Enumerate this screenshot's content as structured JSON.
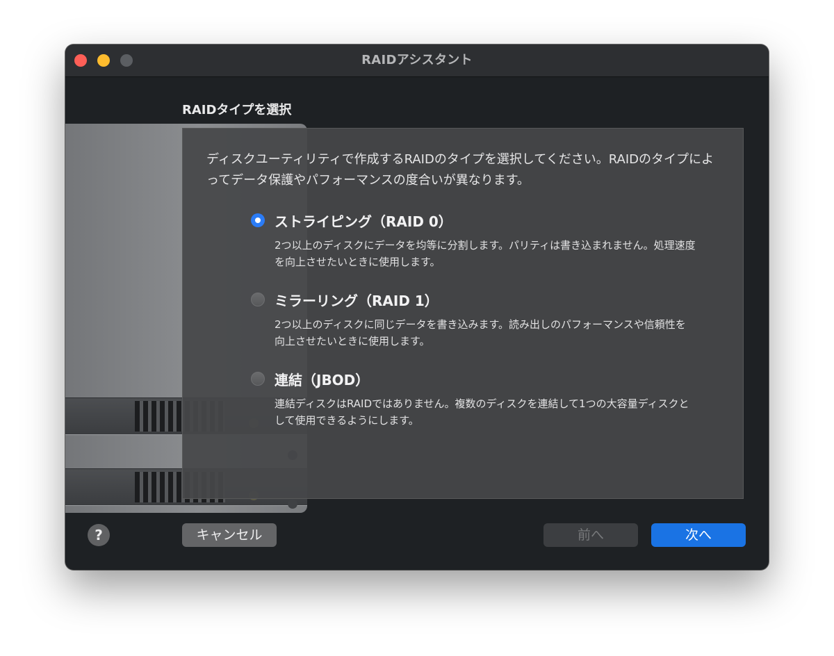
{
  "window": {
    "title": "RAIDアシスタント"
  },
  "page": {
    "section_title": "RAIDタイプを選択",
    "intro": "ディスクユーティリティで作成するRAIDのタイプを選択してください。RAIDのタイプによってデータ保護やパフォーマンスの度合いが異なります。"
  },
  "options": [
    {
      "label": "ストライピング（RAID 0）",
      "description": "2つ以上のディスクにデータを均等に分割します。パリティは書き込まれません。処理速度を向上させたいときに使用します。",
      "selected": true
    },
    {
      "label": "ミラーリング（RAID 1）",
      "description": "2つ以上のディスクに同じデータを書き込みます。読み出しのパフォーマンスや信頼性を向上させたいときに使用します。",
      "selected": false
    },
    {
      "label": "連結（JBOD）",
      "description": "連結ディスクはRAIDではありません。複数のディスクを連結して1つの大容量ディスクとして使用できるようにします。",
      "selected": false
    }
  ],
  "buttons": {
    "help": "?",
    "cancel": "キャンセル",
    "previous": "前へ",
    "next": "次へ",
    "previous_enabled": false
  },
  "colors": {
    "accent": "#1a73e4",
    "radio_selected": "#2b7cf6",
    "window_background": "#1e2124",
    "panel_background": "#464749"
  },
  "icons": {
    "help": "question-mark-icon",
    "traffic_lights": [
      "close-icon",
      "minimize-icon",
      "zoom-icon"
    ],
    "illustration": "raid-device-illustration"
  }
}
